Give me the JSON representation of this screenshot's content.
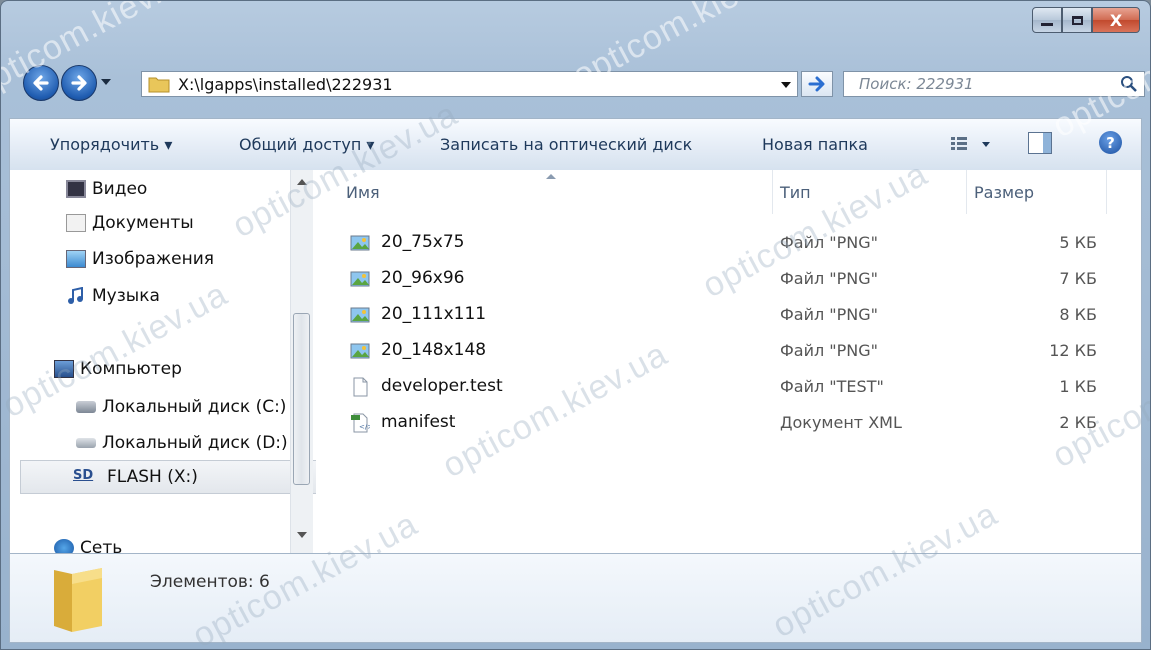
{
  "window": {
    "caption": {
      "minimize": "—",
      "maximize": "□",
      "close": "X"
    }
  },
  "address": {
    "path": "X:\\lgapps\\installed\\222931",
    "search_placeholder": "Поиск: 222931"
  },
  "toolbar": {
    "organize": "Упорядочить ▾",
    "share": "Общий доступ ▾",
    "burn": "Записать на оптический диск",
    "new_folder": "Новая папка"
  },
  "nav": {
    "items": [
      {
        "label": "Видео",
        "icon": "video-icon"
      },
      {
        "label": "Документы",
        "icon": "documents-icon"
      },
      {
        "label": "Изображения",
        "icon": "pictures-icon"
      },
      {
        "label": "Музыка",
        "icon": "music-icon"
      },
      {
        "label": "Компьютер",
        "icon": "computer-icon"
      },
      {
        "label": "Локальный диск (C:)",
        "icon": "drive-c-icon"
      },
      {
        "label": "Локальный диск (D:)",
        "icon": "drive-d-icon"
      },
      {
        "label": "FLASH (X:)",
        "icon": "sd-card-icon"
      },
      {
        "label": "Сеть",
        "icon": "network-icon"
      }
    ]
  },
  "columns": {
    "name": "Имя",
    "type": "Тип",
    "size": "Размер"
  },
  "files": [
    {
      "name": "20_75x75",
      "type": "Файл \"PNG\"",
      "size": "5 КБ",
      "icon": "image-file-icon"
    },
    {
      "name": "20_96x96",
      "type": "Файл \"PNG\"",
      "size": "7 КБ",
      "icon": "image-file-icon"
    },
    {
      "name": "20_111x111",
      "type": "Файл \"PNG\"",
      "size": "8 КБ",
      "icon": "image-file-icon"
    },
    {
      "name": "20_148x148",
      "type": "Файл \"PNG\"",
      "size": "12 КБ",
      "icon": "image-file-icon"
    },
    {
      "name": "developer.test",
      "type": "Файл \"TEST\"",
      "size": "1 КБ",
      "icon": "blank-file-icon"
    },
    {
      "name": "manifest",
      "type": "Документ XML",
      "size": "2 КБ",
      "icon": "xml-file-icon"
    }
  ],
  "status": {
    "count": "Элементов: 6"
  },
  "watermark": "opticom.kiev.ua"
}
